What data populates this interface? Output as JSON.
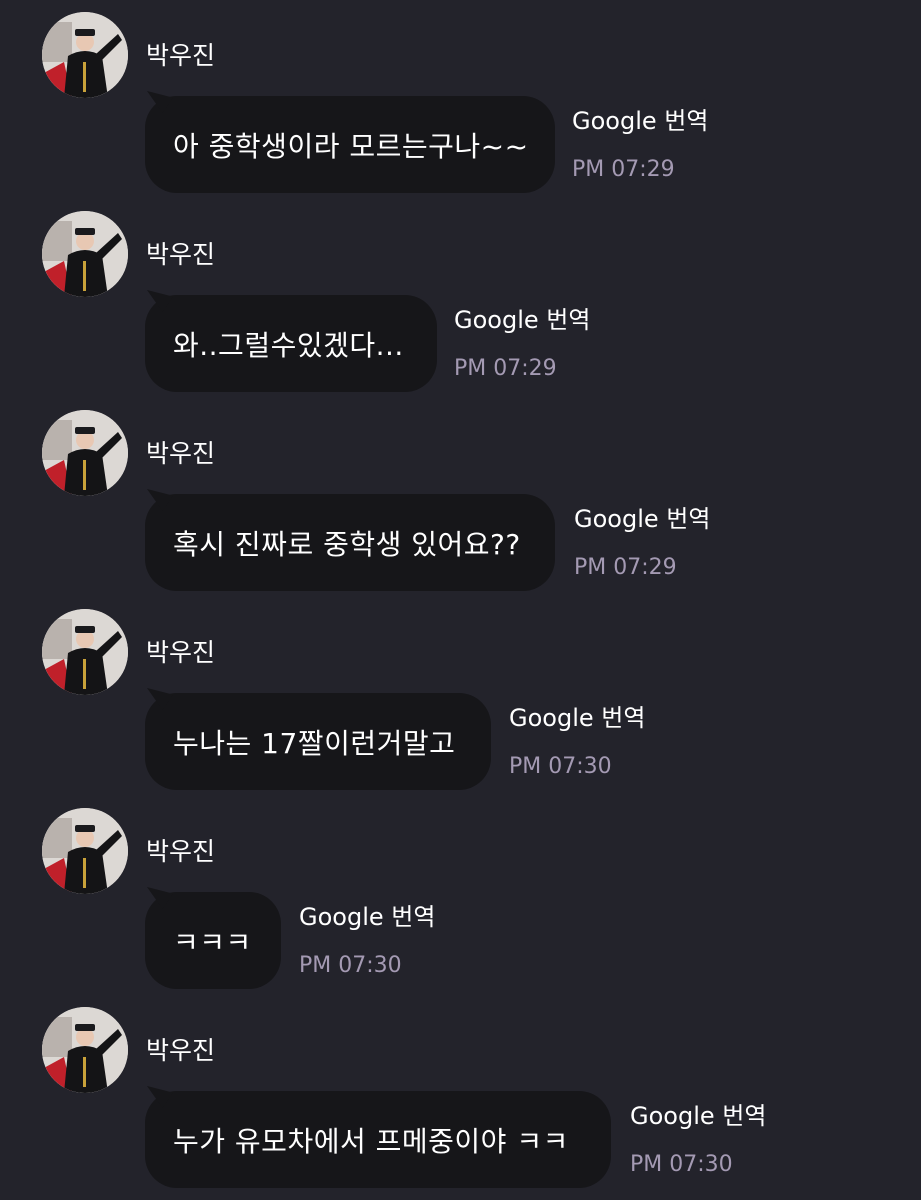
{
  "messages": [
    {
      "sender": "박우진",
      "text": "아 중학생이라 모르는구나~~",
      "translate_label": "Google 번역",
      "time": "PM 07:29"
    },
    {
      "sender": "박우진",
      "text": "와..그럴수있겠다...",
      "translate_label": "Google 번역",
      "time": "PM 07:29"
    },
    {
      "sender": "박우진",
      "text": "혹시 진짜로 중학생 있어요??",
      "translate_label": "Google 번역",
      "time": "PM 07:29"
    },
    {
      "sender": "박우진",
      "text": "누나는 17짤이런거말고",
      "translate_label": "Google 번역",
      "time": "PM 07:30"
    },
    {
      "sender": "박우진",
      "text": "ㅋㅋㅋ",
      "translate_label": "Google 번역",
      "time": "PM 07:30"
    },
    {
      "sender": "박우진",
      "text": "누가 유모차에서 프메중이야 ㅋㅋ",
      "translate_label": "Google 번역",
      "time": "PM 07:30"
    }
  ],
  "avatar_icon": "profile-photo-pilot-salute",
  "colors": {
    "background": "#23232b",
    "bubble": "#161619",
    "text": "#ffffff",
    "timestamp": "#a49ab3"
  }
}
